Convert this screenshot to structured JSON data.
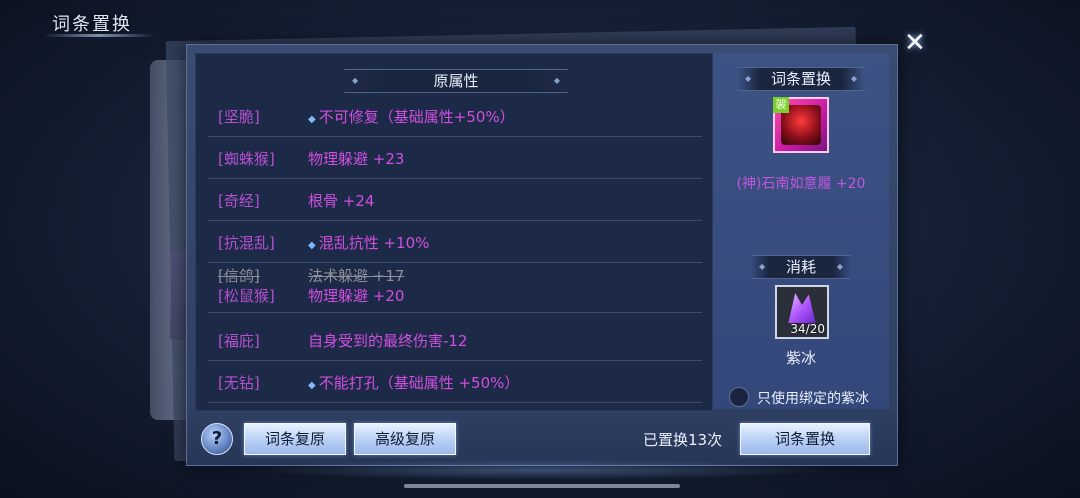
{
  "screen": {
    "title": "词条置换",
    "close_glyph": "✕"
  },
  "original_attrs": {
    "header": "原属性",
    "rows": [
      {
        "tag": "[坚脆]",
        "value": "不可修复（基础属性+50%）",
        "special": true
      },
      {
        "tag": "[蜘蛛猴]",
        "value": "物理躲避 +23",
        "special": false
      },
      {
        "tag": "[奇经]",
        "value": "根骨 +24",
        "special": false
      },
      {
        "tag": "[抗混乱]",
        "value": "混乱抗性 +10%",
        "special": true
      },
      {
        "tag": "[信鸽]",
        "value": "法术躲避 +17",
        "special": false,
        "struck": true,
        "replacement": {
          "tag": "[松鼠猴]",
          "value": "物理躲避 +20"
        }
      },
      {
        "tag": "[福庇]",
        "value": "自身受到的最终伤害-12",
        "special": false
      },
      {
        "tag": "[无钻]",
        "value": "不能打孔（基础属性 +50%）",
        "special": true
      }
    ]
  },
  "swap_panel": {
    "header": "词条置换",
    "item": {
      "badge": "袈",
      "name": "(神)石南如意履 +20",
      "icon": "shoe-icon"
    },
    "cost_header": "消耗",
    "cost_item": {
      "count": "34/20",
      "name": "紫冰",
      "icon": "purple-crystal-icon"
    },
    "only_bound_label": "只使用绑定的紫冰",
    "only_bound_checked": false
  },
  "bottom": {
    "help_label": "?",
    "restore_label": "词条复原",
    "advanced_restore_label": "高级复原",
    "swap_count_text": "已置换13次",
    "swap_button_label": "词条置换"
  },
  "colors": {
    "tag": "#b64fd0",
    "value": "#d04ee0",
    "struck": "#8c8f99",
    "panel": "#2e3e60"
  }
}
